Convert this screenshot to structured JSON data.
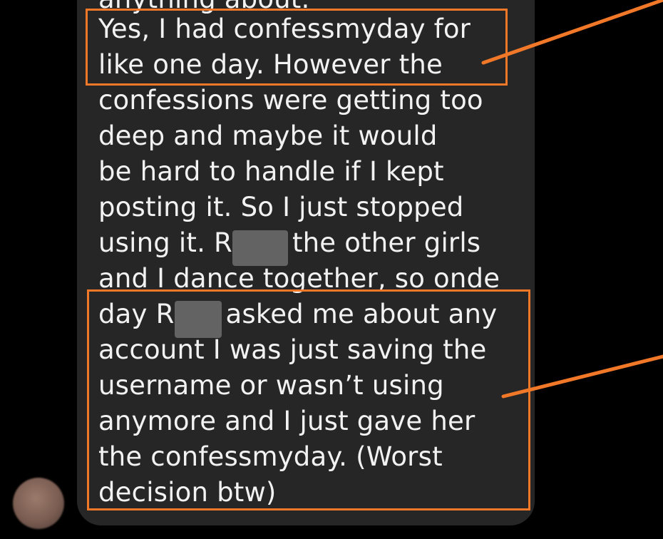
{
  "message": {
    "lines": [
      "anything about.",
      "Yes, I had confessmyday for",
      "like one day. However the",
      "confessions were getting too",
      "deep and maybe it would",
      "be hard to handle if I kept",
      "posting it. So I just stopped",
      "using it. R",
      "the other girls",
      "and I dance together, so onde",
      "day R",
      "asked me about any",
      "account I was just saving the",
      "username or wasn’t  using",
      "anymore and I just gave her",
      "the confessmyday. (Worst",
      "decision btw)"
    ]
  },
  "annotation": {
    "color": "#f07828"
  },
  "colors": {
    "background": "#000000",
    "bubble": "#262626",
    "text": "#f2f2f2"
  }
}
